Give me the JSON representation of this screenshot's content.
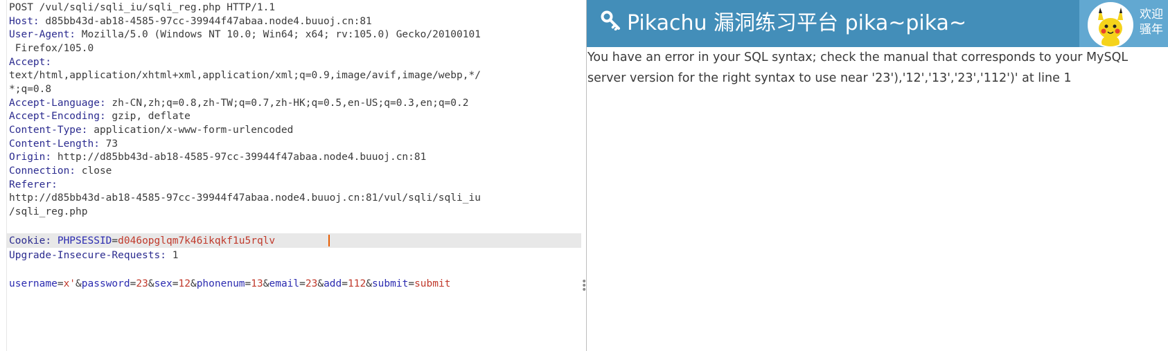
{
  "request": {
    "lines": [
      {
        "key": "POST /vul/sqli/sqli_iu/sqli_reg.php HTTP/1.1",
        "val": ""
      },
      {
        "key": "Host:",
        "val": " d85bb43d-ab18-4585-97cc-39944f47abaa.node4.buuoj.cn:81"
      },
      {
        "key": "User-Agent:",
        "val": " Mozilla/5.0 (Windows NT 10.0; Win64; x64; rv:105.0) Gecko/20100101"
      },
      {
        "key": "",
        "val": " Firefox/105.0"
      },
      {
        "key": "Accept:",
        "val": ""
      },
      {
        "key": "",
        "val": "text/html,application/xhtml+xml,application/xml;q=0.9,image/avif,image/webp,*/"
      },
      {
        "key": "",
        "val": "*;q=0.8"
      },
      {
        "key": "Accept-Language:",
        "val": " zh-CN,zh;q=0.8,zh-TW;q=0.7,zh-HK;q=0.5,en-US;q=0.3,en;q=0.2"
      },
      {
        "key": "Accept-Encoding:",
        "val": " gzip, deflate"
      },
      {
        "key": "Content-Type:",
        "val": " application/x-www-form-urlencoded"
      },
      {
        "key": "Content-Length:",
        "val": " 73"
      },
      {
        "key": "Origin:",
        "val": " http://d85bb43d-ab18-4585-97cc-39944f47abaa.node4.buuoj.cn:81"
      },
      {
        "key": "Connection:",
        "val": " close"
      },
      {
        "key": "Referer:",
        "val": ""
      },
      {
        "key": "",
        "val": "http://d85bb43d-ab18-4585-97cc-39944f47abaa.node4.buuoj.cn:81/vul/sqli/sqli_iu"
      },
      {
        "key": "",
        "val": "/sqli_reg.php"
      }
    ],
    "cookie": {
      "key": "Cookie:",
      "name": "PHPSESSID",
      "eq": "=",
      "value": "d046opglqm7k46ikqkf1u5rqlv"
    },
    "upgrade": {
      "key": "Upgrade-Insecure-Requests:",
      "val": " 1"
    },
    "body": [
      {
        "k": "username",
        "v": "x'"
      },
      {
        "k": "password",
        "v": "23"
      },
      {
        "k": "sex",
        "v": "12"
      },
      {
        "k": "phonenum",
        "v": "13"
      },
      {
        "k": "email",
        "v": "23"
      },
      {
        "k": "add",
        "v": "112"
      },
      {
        "k": "submit",
        "v": "submit"
      }
    ]
  },
  "response": {
    "banner_title": "Pikachu 漏洞练习平台 pika~pika~",
    "welcome": "欢迎\n骚年",
    "error_text": "You have an error in your SQL syntax; check the manual that corresponds to your MySQL\nserver version for the right syntax to use near '23'),'12','13','23','112')' at line 1"
  },
  "icons": {
    "banner": "key-icon",
    "avatar": "pikachu-avatar",
    "handle": "drag-handle-icon"
  },
  "colors": {
    "banner": "#438eb9",
    "userbox": "#62a8d1",
    "header_key": "#2b2b8f",
    "param_value": "#c0392b"
  }
}
